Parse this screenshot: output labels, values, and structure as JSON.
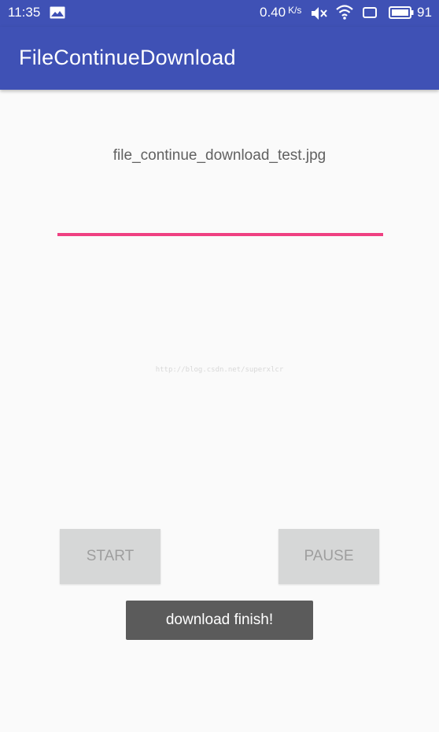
{
  "status_bar": {
    "time": "11:35",
    "network_speed": "0.40",
    "network_speed_unit": "K/s",
    "battery_level": "91",
    "icons": [
      "image-icon",
      "mute-icon",
      "wifi-icon",
      "screen-icon",
      "battery-icon"
    ]
  },
  "app_bar": {
    "title": "FileContinueDownload",
    "color": "#3f51b5"
  },
  "main": {
    "file_name": "file_continue_download_test.jpg",
    "download_progress": 1.0,
    "progress_color": "#ef4081",
    "watermark": "http://blog.csdn.net/superxlcr"
  },
  "buttons": {
    "start_label": "START",
    "pause_label": "PAUSE"
  },
  "toast": {
    "message": "download finish!"
  }
}
